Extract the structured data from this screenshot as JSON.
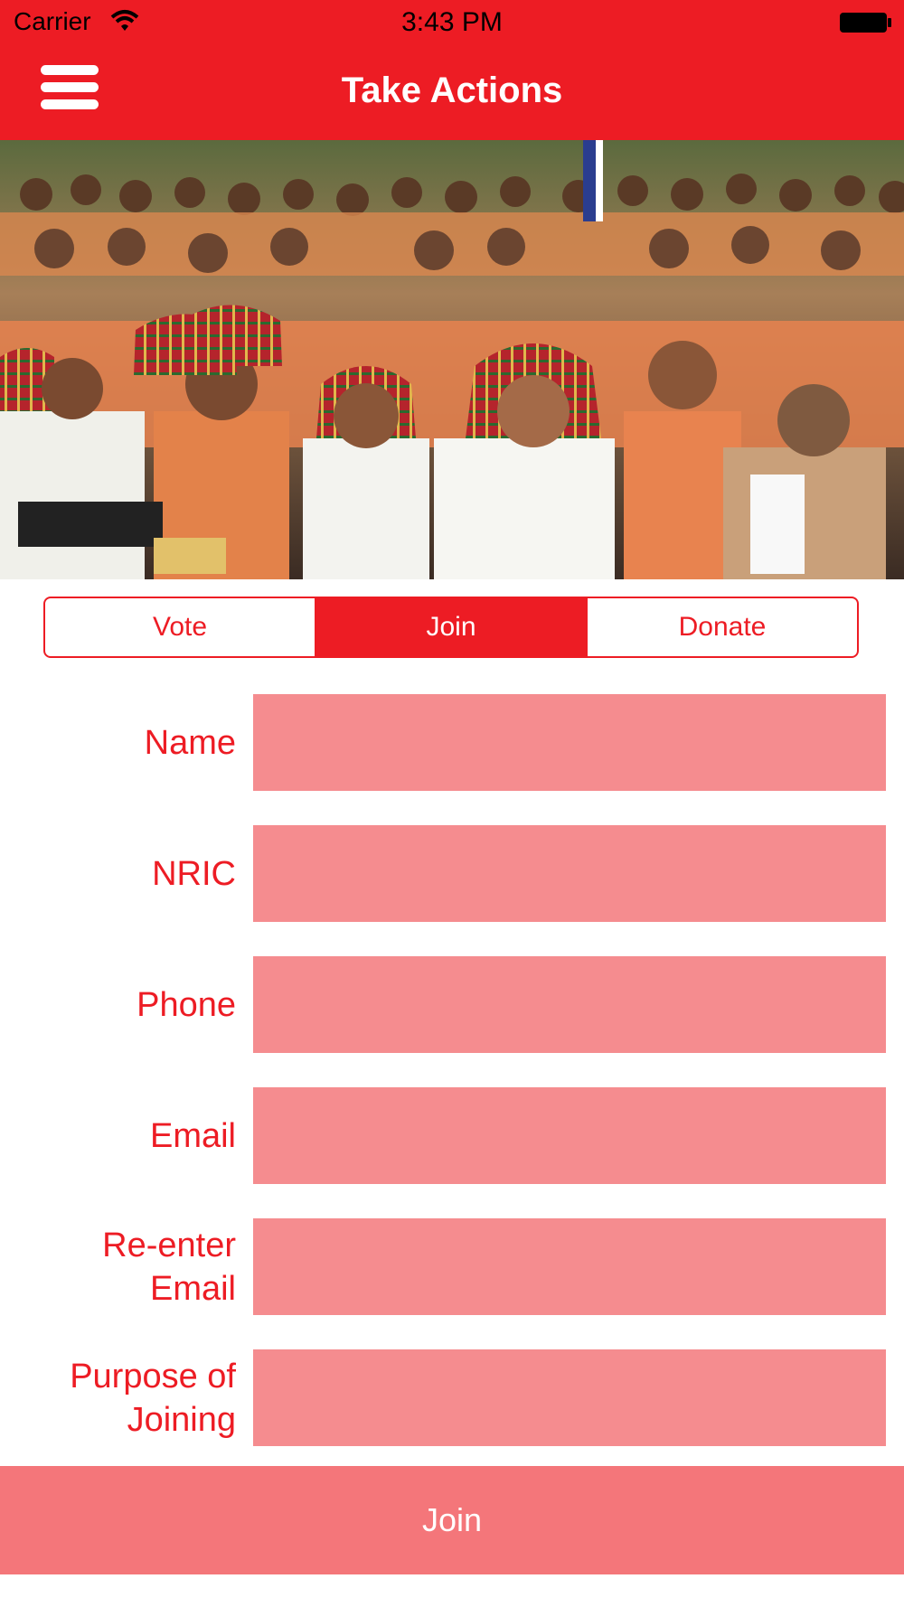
{
  "status_bar": {
    "carrier": "Carrier",
    "time": "3:43 PM"
  },
  "nav": {
    "title": "Take Actions",
    "menu_icon": "hamburger-icon"
  },
  "hero": {
    "image_icon": "crowd-photo"
  },
  "tabs": [
    {
      "label": "Vote",
      "active": false
    },
    {
      "label": "Join",
      "active": true
    },
    {
      "label": "Donate",
      "active": false
    }
  ],
  "form": {
    "fields": [
      {
        "label": "Name",
        "value": ""
      },
      {
        "label": "NRIC",
        "value": ""
      },
      {
        "label": "Phone",
        "value": ""
      },
      {
        "label": "Email",
        "value": ""
      },
      {
        "label": "Re-enter Email",
        "value": ""
      },
      {
        "label": "Purpose of Joining",
        "value": ""
      }
    ],
    "submit_label": "Join"
  },
  "colors": {
    "primary": "#ED1C24",
    "field": "#F58C8F",
    "button": "#F4767A"
  }
}
